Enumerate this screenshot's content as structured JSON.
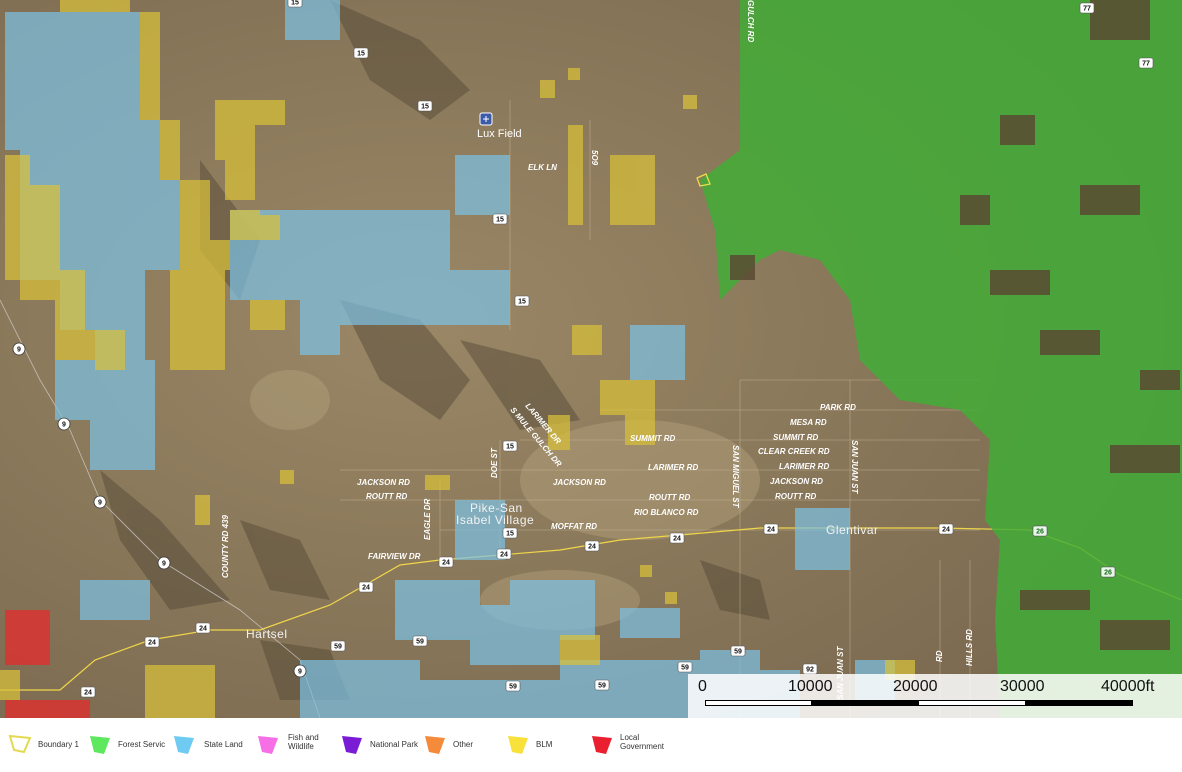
{
  "map": {
    "places": {
      "lux_field": "Lux Field",
      "pike_san_isabel_line1": "Pike-San",
      "pike_san_isabel_line2": "Isabel Village",
      "glentivar": "Glentivar",
      "hartsel": "Hartsel"
    },
    "roads": {
      "elk_ln": "ELK LN",
      "r5": "5O9",
      "jackson_rd_w": "JACKSON RD",
      "routt_rd_w": "ROUTT RD",
      "fairview_dr": "FAIRVIEW DR",
      "eagle_dr": "EAGLE DR",
      "doe_st": "DOE ST",
      "county_rd_439": "COUNTY RD 439",
      "larimer_dr": "LARIMER DR",
      "s_mule_gulch_dr": "S MULE GULCH DR",
      "summit_rd_c": "SUMMIT RD",
      "jackson_rd_c": "JACKSON RD",
      "moffat_rd": "MOFFAT RD",
      "larimer_rd_c": "LARIMER RD",
      "routt_rd_c": "ROUTT RD",
      "rio_blanco_rd": "RIO BLANCO RD",
      "san_miguel_st": "SAN MIGUEL ST",
      "mesa_rd": "MESA RD",
      "park_rd": "PARK RD",
      "summit_rd_e": "SUMMIT RD",
      "clear_creek_rd": "CLEAR CREEK RD",
      "larimer_rd_e": "LARIMER RD",
      "jackson_rd_e": "JACKSON RD",
      "routt_rd_e": "ROUTT RD",
      "san_juan_st_n": "SAN JUAN ST",
      "san_juan_st_s": "SAN JUAN ST",
      "gulch_rd": "GULCH RD",
      "rd_s": "RD",
      "hills_rd": "HILLS RD"
    },
    "shields": [
      {
        "id": "s15a",
        "label": "15"
      },
      {
        "id": "s15b",
        "label": "15"
      },
      {
        "id": "s15c",
        "label": "15"
      },
      {
        "id": "s15d",
        "label": "15"
      },
      {
        "id": "s15e",
        "label": "15"
      },
      {
        "id": "s15f",
        "label": "15"
      },
      {
        "id": "s15g",
        "label": "15"
      },
      {
        "id": "s9a",
        "label": "9"
      },
      {
        "id": "s9b",
        "label": "9"
      },
      {
        "id": "s9c",
        "label": "9"
      },
      {
        "id": "s9d",
        "label": "9"
      },
      {
        "id": "s9e",
        "label": "9"
      },
      {
        "id": "s24a",
        "label": "24"
      },
      {
        "id": "s24b",
        "label": "24"
      },
      {
        "id": "s24c",
        "label": "24"
      },
      {
        "id": "s24d",
        "label": "24"
      },
      {
        "id": "s24e",
        "label": "24"
      },
      {
        "id": "s24f",
        "label": "24"
      },
      {
        "id": "s24g",
        "label": "24"
      },
      {
        "id": "s24h",
        "label": "24"
      },
      {
        "id": "s24i",
        "label": "24"
      },
      {
        "id": "s24j",
        "label": "24"
      },
      {
        "id": "s24k",
        "label": "24"
      },
      {
        "id": "s24l",
        "label": "24"
      },
      {
        "id": "s26a",
        "label": "26"
      },
      {
        "id": "s26b",
        "label": "26"
      },
      {
        "id": "s59a",
        "label": "59"
      },
      {
        "id": "s59b",
        "label": "59"
      },
      {
        "id": "s59c",
        "label": "59"
      },
      {
        "id": "s59d",
        "label": "59"
      },
      {
        "id": "s59e",
        "label": "59"
      },
      {
        "id": "s59f",
        "label": "59"
      },
      {
        "id": "s92",
        "label": "92"
      },
      {
        "id": "s77a",
        "label": "77"
      },
      {
        "id": "s77b",
        "label": "77"
      }
    ]
  },
  "scale_bar": {
    "ticks": [
      "0",
      "10000",
      "20000",
      "30000",
      "40000ft"
    ]
  },
  "legend": {
    "items": [
      {
        "key": "boundary",
        "label": "Boundary 1",
        "color": "#e3da4f"
      },
      {
        "key": "forest",
        "label": "Forest Servic",
        "color": "#5ee85e"
      },
      {
        "key": "state",
        "label": "State Land",
        "color": "#6fcbf2"
      },
      {
        "key": "fish",
        "label_line1": "Fish and",
        "label_line2": "Wildlife",
        "color": "#f76fe6"
      },
      {
        "key": "park",
        "label": "National Park",
        "color": "#7a1cd6"
      },
      {
        "key": "other",
        "label": "Other",
        "color": "#f58a3a"
      },
      {
        "key": "blm",
        "label": "BLM",
        "color": "#f7e13a"
      },
      {
        "key": "local",
        "label_line1": "Local",
        "label_line2": "Government",
        "color": "#ea2030"
      }
    ]
  },
  "colors": {
    "terrain": "#8d7a5e",
    "forest_overlay": "#3da634",
    "state_overlay": "#7cc2e6",
    "blm_overlay": "#d8c13a",
    "local_overlay": "#e0302f",
    "highway_line": "#f0d64a"
  }
}
